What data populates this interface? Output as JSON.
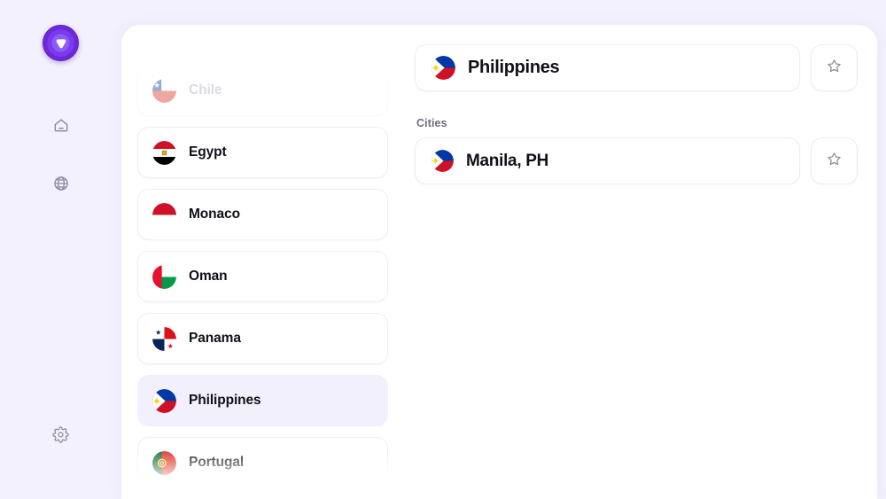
{
  "app": {
    "background": "#f4f1fe",
    "accent": "#7c3aed",
    "panel_background": "#ffffff"
  },
  "rail": {
    "logo_name": "app-logo",
    "items": [
      {
        "icon": "home-icon",
        "name": "nav-home"
      },
      {
        "icon": "globe-icon",
        "name": "nav-globe"
      },
      {
        "icon": "gear-icon",
        "name": "nav-settings"
      }
    ]
  },
  "countries": {
    "list": [
      {
        "label": "Chile",
        "flag": "cl",
        "selected": false,
        "ghost": true
      },
      {
        "label": "Egypt",
        "flag": "eg",
        "selected": false,
        "ghost": false
      },
      {
        "label": "Monaco",
        "flag": "mc",
        "selected": false,
        "ghost": false
      },
      {
        "label": "Oman",
        "flag": "om",
        "selected": false,
        "ghost": false
      },
      {
        "label": "Panama",
        "flag": "pa",
        "selected": false,
        "ghost": false
      },
      {
        "label": "Philippines",
        "flag": "ph",
        "selected": true,
        "ghost": false
      },
      {
        "label": "Portugal",
        "flag": "pt",
        "selected": false,
        "ghost": false
      }
    ]
  },
  "detail": {
    "country": {
      "label": "Philippines",
      "flag": "ph"
    },
    "favorite_label": "star-icon",
    "favorited": false,
    "cities_heading": "Cities",
    "cities": [
      {
        "label": "Manila, PH",
        "flag": "ph",
        "favorited": false
      }
    ]
  }
}
